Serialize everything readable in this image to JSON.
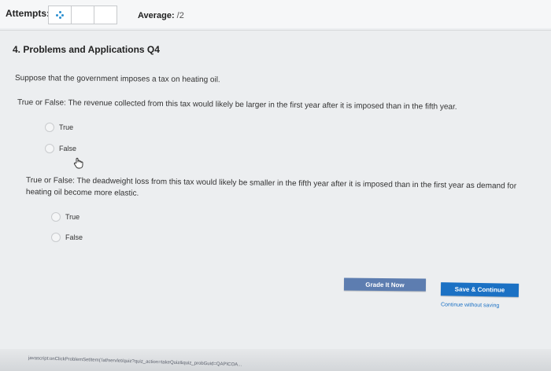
{
  "header": {
    "attempts_label": "Attempts:",
    "attempt_slots": 3,
    "average_label": "Average:",
    "average_value": "/2"
  },
  "question": {
    "title": "4. Problems and Applications Q4",
    "intro": "Suppose that the government imposes a tax on heating oil.",
    "parts": [
      {
        "statement": "True or False: The revenue collected from this tax would likely be larger in the first year after it is imposed than in the fifth year.",
        "options": [
          "True",
          "False"
        ]
      },
      {
        "statement": "True or False: The deadweight loss from this tax would likely be smaller in the fifth year after it is imposed than in the first year as demand for heating oil become more elastic.",
        "options": [
          "True",
          "False"
        ]
      }
    ]
  },
  "actions": {
    "grade_label": "Grade It Now",
    "save_label": "Save & Continue",
    "continue_label": "Continue without saving"
  },
  "statusbar": {
    "url": "javascript:onClickProblemSetItem('/af/servlet/quiz?quiz_action=takeQuiz&quiz_probGuid=QAPICOA..."
  },
  "colors": {
    "grade_button": "#5d7db0",
    "save_button": "#1b71c4",
    "accent_dots": "#2a8fd0"
  }
}
